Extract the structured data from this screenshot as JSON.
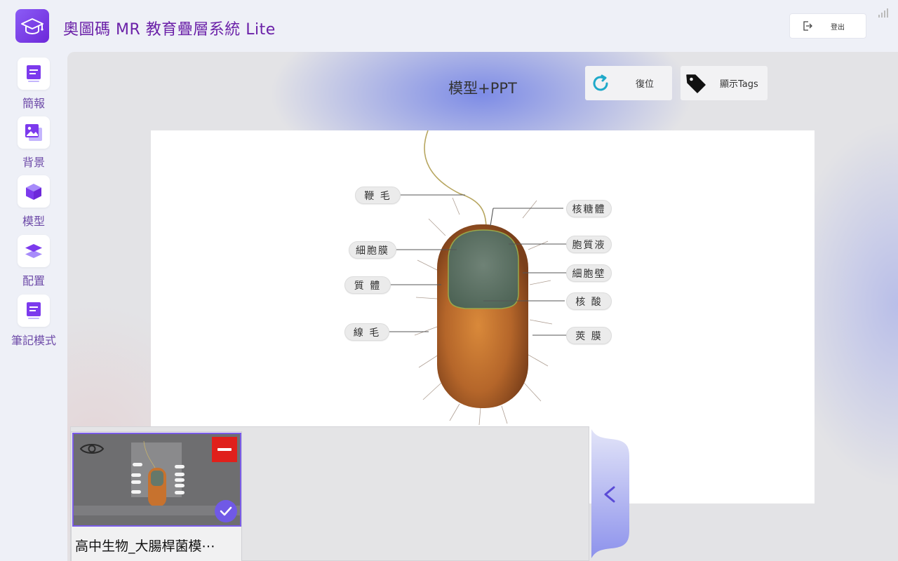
{
  "app": {
    "title": "奧圖碼 MR 教育疊層系統 Lite",
    "logo_icon": "graduation-cap-icon",
    "accent_color": "#7c3aed"
  },
  "header": {
    "logout_label": "登出",
    "logout_icon": "logout-icon",
    "status_icon": "signal-strength-icon"
  },
  "sidebar": {
    "items": [
      {
        "label": "簡報",
        "icon": "presentation-icon"
      },
      {
        "label": "背景",
        "icon": "image-icon"
      },
      {
        "label": "模型",
        "icon": "cube-icon"
      },
      {
        "label": "配置",
        "icon": "layers-icon"
      },
      {
        "label": "筆記模式",
        "icon": "note-icon"
      }
    ]
  },
  "stage": {
    "title": "模型+PPT",
    "reset_label": "復位",
    "reset_icon": "refresh-icon",
    "tags_label": "顯示Tags",
    "tags_icon": "tag-icon"
  },
  "slide": {
    "labels_left": [
      "鞭 毛",
      "細胞膜",
      "質 體",
      "線 毛"
    ],
    "labels_right": [
      "核糖體",
      "胞質液",
      "細胞壁",
      "核 酸",
      "莢 膜"
    ]
  },
  "tray": {
    "cards": [
      {
        "name": "高中生物_大腸桿菌模⋯",
        "selected": true
      }
    ],
    "collapse_icon": "chevron-left-icon",
    "remove_color": "#e0201b"
  }
}
